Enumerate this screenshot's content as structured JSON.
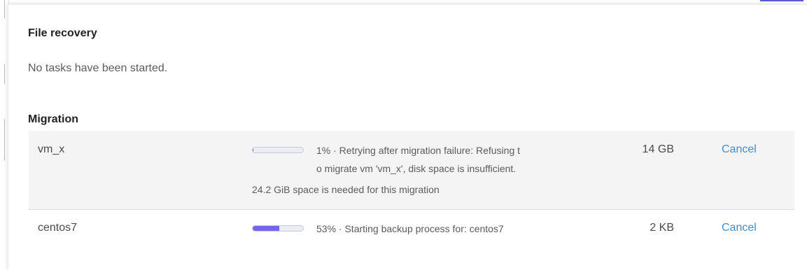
{
  "file_recovery": {
    "title": "File recovery",
    "empty_message": "No tasks have been started."
  },
  "migration": {
    "title": "Migration",
    "tasks": [
      {
        "name": "vm_x",
        "progress_percent": 1,
        "status_line_1": "1% · Retrying after migration failure: Refusing t",
        "status_line_2": "o migrate vm 'vm_x', disk space is insufficient.",
        "status_line_3": "24.2 GiB space is needed for this migration",
        "size": "14 GB",
        "cancel_label": "Cancel"
      },
      {
        "name": "centos7",
        "progress_percent": 53,
        "status_line_1": "53% · Starting backup process for: centos7",
        "size": "2 KB",
        "cancel_label": "Cancel"
      }
    ]
  },
  "colors": {
    "progress_fill": "#7467e6",
    "link": "#3f8fc7",
    "row_highlight": "#f4f4f4"
  }
}
